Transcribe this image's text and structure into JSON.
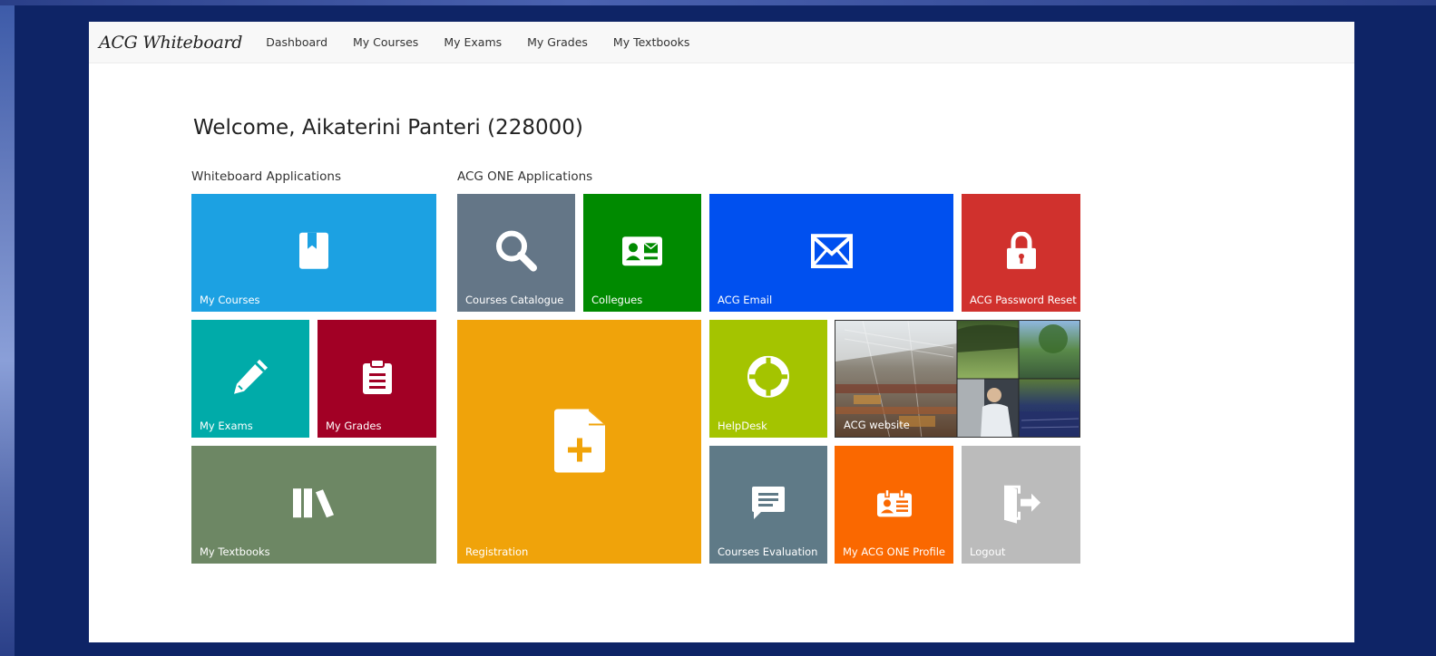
{
  "navbar": {
    "brand": "ACG Whiteboard",
    "links": [
      "Dashboard",
      "My Courses",
      "My Exams",
      "My Grades",
      "My Textbooks"
    ]
  },
  "welcome": "Welcome, Aikaterini Panteri (228000)",
  "sections": {
    "whiteboard": "Whiteboard Applications",
    "acg_one": "ACG ONE Applications"
  },
  "tiles": {
    "my_courses": {
      "label": "My Courses",
      "color": "#1ca1e2",
      "icon": "book-icon"
    },
    "my_exams": {
      "label": "My Exams",
      "color": "#00aba9",
      "icon": "pencil-icon"
    },
    "my_grades": {
      "label": "My Grades",
      "color": "#a20025",
      "icon": "clipboard-icon"
    },
    "my_textbooks": {
      "label": "My Textbooks",
      "color": "#6d8764",
      "icon": "books-icon"
    },
    "courses_catalogue": {
      "label": "Courses Catalogue",
      "color": "#647687",
      "icon": "search-icon"
    },
    "collegues": {
      "label": "Collegues",
      "color": "#008a00",
      "icon": "contact-card-icon"
    },
    "acg_email": {
      "label": "ACG Email",
      "color": "#0050ef",
      "icon": "mail-icon"
    },
    "acg_password_reset": {
      "label": "ACG Password Reset",
      "color": "#d0312d",
      "icon": "lock-icon"
    },
    "registration": {
      "label": "Registration",
      "color": "#f0a30a",
      "icon": "document-add-icon"
    },
    "helpdesk": {
      "label": "HelpDesk",
      "color": "#a4c400",
      "icon": "lifebuoy-icon"
    },
    "acg_website": {
      "label": "ACG website",
      "color": "#555555",
      "icon": "campus-photos"
    },
    "courses_evaluation": {
      "label": "Courses Evaluation",
      "color": "#5f7a87",
      "icon": "chat-icon"
    },
    "my_acg_one_profile": {
      "label": "My ACG ONE Profile",
      "color": "#fa6800",
      "icon": "id-badge-icon"
    },
    "logout": {
      "label": "Logout",
      "color": "#bbbbbb",
      "icon": "logout-door-icon"
    }
  }
}
